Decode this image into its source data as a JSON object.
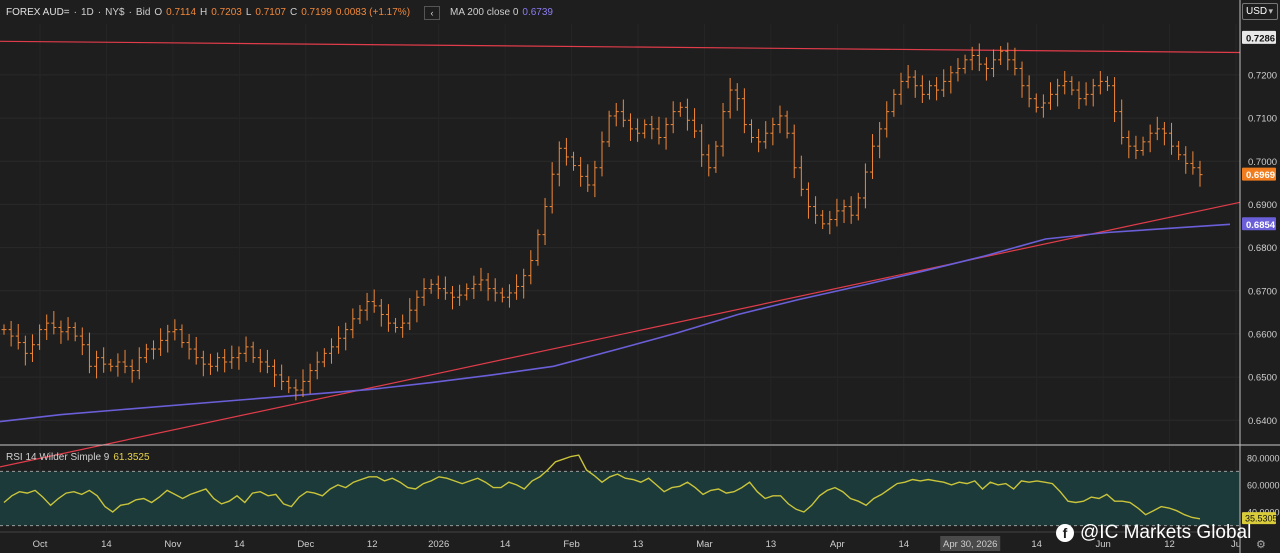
{
  "header": {
    "symbol": "FOREX AUD=",
    "interval": "1D",
    "venue": "NY$",
    "side": "Bid",
    "open_label": "O",
    "open": "0.7114",
    "high_label": "H",
    "high": "0.7203",
    "low_label": "L",
    "low": "0.7107",
    "close_label": "C",
    "close": "0.7199",
    "change": "0.0083 (+1.17%)",
    "collapse_icon": "chevron-left-icon",
    "ma_label": "MA 200 close 0",
    "ma_value": "0.6739"
  },
  "currency_button": "USD",
  "rsi": {
    "label": "RSI 14 Wilder Simple 9",
    "value": "61.3525"
  },
  "watermark": "@IC Markets Global",
  "colors": {
    "background": "#1e1e1e",
    "bars": "#f0883a",
    "ma": "#6a5fd8",
    "trendline": "#e03c4a",
    "rsi": "#c9c43a",
    "rsi_band": "#1c3a3a",
    "price_tag": "#f07c1e",
    "ma_tag": "#6a5fd8",
    "top_tag": "#e8e8e8"
  },
  "chart_data": {
    "type": "ohlc",
    "price_axis": {
      "ticks": [
        "0.7200",
        "0.7100",
        "0.7000",
        "0.6900",
        "0.6800",
        "0.6700",
        "0.6600",
        "0.6500",
        "0.6400"
      ],
      "range": [
        0.6345,
        0.7318
      ]
    },
    "price_tags": {
      "top": "0.7286",
      "last": "0.6969",
      "ma": "0.6854"
    },
    "time_axis": {
      "labels": [
        "Oct",
        "14",
        "Nov",
        "14",
        "Dec",
        "12",
        "2026",
        "14",
        "Feb",
        "13",
        "Mar",
        "13",
        "Apr",
        "14",
        "Apr 30, 2026",
        "14",
        "Jun",
        "12",
        "Ju"
      ],
      "highlighted": "Apr 30, 2026"
    },
    "rsi_axis": {
      "ticks": [
        "80.0000",
        "60.0000",
        "40.0000"
      ],
      "last_tag": "35.5305",
      "range": [
        26,
        88
      ],
      "band": [
        30,
        70
      ]
    },
    "series": [
      {
        "name": "FOREX AUD=",
        "kind": "ohlc_closes",
        "values": [
          0.661,
          0.6595,
          0.658,
          0.6555,
          0.6575,
          0.661,
          0.6625,
          0.6615,
          0.6605,
          0.6615,
          0.6595,
          0.6575,
          0.6525,
          0.6545,
          0.653,
          0.6525,
          0.6535,
          0.6525,
          0.6515,
          0.6545,
          0.6565,
          0.6565,
          0.6585,
          0.6605,
          0.661,
          0.658,
          0.6565,
          0.6545,
          0.653,
          0.6525,
          0.6545,
          0.6535,
          0.6545,
          0.6555,
          0.657,
          0.6545,
          0.6535,
          0.6525,
          0.6505,
          0.649,
          0.6475,
          0.647,
          0.649,
          0.6515,
          0.6535,
          0.6555,
          0.657,
          0.659,
          0.661,
          0.6635,
          0.6655,
          0.6675,
          0.6665,
          0.6645,
          0.6625,
          0.6615,
          0.6625,
          0.6655,
          0.6685,
          0.6705,
          0.6715,
          0.6705,
          0.6695,
          0.6685,
          0.669,
          0.6705,
          0.6715,
          0.6725,
          0.6705,
          0.6695,
          0.6685,
          0.6695,
          0.671,
          0.6735,
          0.677,
          0.683,
          0.6895,
          0.697,
          0.703,
          0.701,
          0.699,
          0.6965,
          0.6945,
          0.6985,
          0.7045,
          0.7105,
          0.7115,
          0.7095,
          0.7075,
          0.7065,
          0.7085,
          0.7075,
          0.7055,
          0.7085,
          0.7115,
          0.7125,
          0.7095,
          0.707,
          0.7015,
          0.6985,
          0.7035,
          0.7115,
          0.7165,
          0.7145,
          0.7085,
          0.7055,
          0.7045,
          0.7065,
          0.7085,
          0.7105,
          0.7065,
          0.6985,
          0.6935,
          0.6895,
          0.6875,
          0.6855,
          0.6865,
          0.6885,
          0.6895,
          0.6875,
          0.6915,
          0.6975,
          0.7035,
          0.7075,
          0.7115,
          0.7155,
          0.7185,
          0.7195,
          0.7175,
          0.7155,
          0.7175,
          0.7165,
          0.7185,
          0.7205,
          0.7215,
          0.7235,
          0.7245,
          0.7225,
          0.7215,
          0.7235,
          0.7255,
          0.7235,
          0.7215,
          0.7175,
          0.7145,
          0.7125,
          0.7135,
          0.7155,
          0.7175,
          0.7185,
          0.7165,
          0.7145,
          0.7155,
          0.7175,
          0.7185,
          0.7175,
          0.7115,
          0.7055,
          0.7035,
          0.7025,
          0.7045,
          0.7065,
          0.7075,
          0.7065,
          0.7035,
          0.7015,
          0.6995,
          0.6985,
          0.6969
        ]
      },
      {
        "name": "MA 200 close 0",
        "kind": "line",
        "points": [
          [
            0,
            0.6397
          ],
          [
            0.05,
            0.6413
          ],
          [
            0.1,
            0.6425
          ],
          [
            0.2,
            0.6448
          ],
          [
            0.3,
            0.6471
          ],
          [
            0.35,
            0.6487
          ],
          [
            0.4,
            0.6505
          ],
          [
            0.45,
            0.6525
          ],
          [
            0.5,
            0.6563
          ],
          [
            0.55,
            0.6602
          ],
          [
            0.6,
            0.6645
          ],
          [
            0.65,
            0.668
          ],
          [
            0.7,
            0.6712
          ],
          [
            0.75,
            0.6745
          ],
          [
            0.8,
            0.678
          ],
          [
            0.85,
            0.682
          ],
          [
            0.9,
            0.6835
          ],
          [
            1.0,
            0.6854
          ]
        ]
      },
      {
        "name": "trendline-upper",
        "kind": "line",
        "points": [
          [
            0,
            0.7278
          ],
          [
            1.0,
            0.7252
          ]
        ]
      },
      {
        "name": "trendline-lower",
        "kind": "line",
        "points": [
          [
            0,
            0.6292
          ],
          [
            1.0,
            0.6905
          ]
        ]
      },
      {
        "name": "RSI 14",
        "kind": "rsi",
        "values": [
          47,
          52,
          55,
          54,
          56,
          51,
          45,
          50,
          54,
          55,
          53,
          56,
          52,
          44,
          40,
          45,
          46,
          49,
          50,
          47,
          51,
          56,
          53,
          50,
          53,
          55,
          57,
          50,
          46,
          48,
          52,
          47,
          54,
          55,
          52,
          53,
          46,
          44,
          51,
          55,
          54,
          52,
          57,
          60,
          58,
          62,
          64,
          66,
          66,
          63,
          65,
          62,
          58,
          57,
          61,
          63,
          66,
          65,
          63,
          61,
          63,
          65,
          62,
          58,
          58,
          62,
          60,
          57,
          63,
          66,
          71,
          77,
          79,
          81,
          82,
          71,
          67,
          62,
          66,
          68,
          65,
          64,
          62,
          65,
          60,
          55,
          58,
          59,
          62,
          58,
          53,
          56,
          57,
          54,
          55,
          58,
          62,
          55,
          50,
          52,
          52,
          46,
          42,
          40,
          45,
          52,
          56,
          58,
          55,
          50,
          48,
          45,
          50,
          53,
          57,
          61,
          62,
          64,
          63,
          64,
          63,
          62,
          60,
          62,
          61,
          63,
          57,
          62,
          60,
          61,
          57,
          63,
          62,
          63,
          62,
          61,
          55,
          48,
          47,
          48,
          51,
          50,
          53,
          48,
          48,
          47,
          43,
          38,
          41,
          44,
          43,
          41,
          38,
          36,
          35
        ]
      }
    ]
  }
}
